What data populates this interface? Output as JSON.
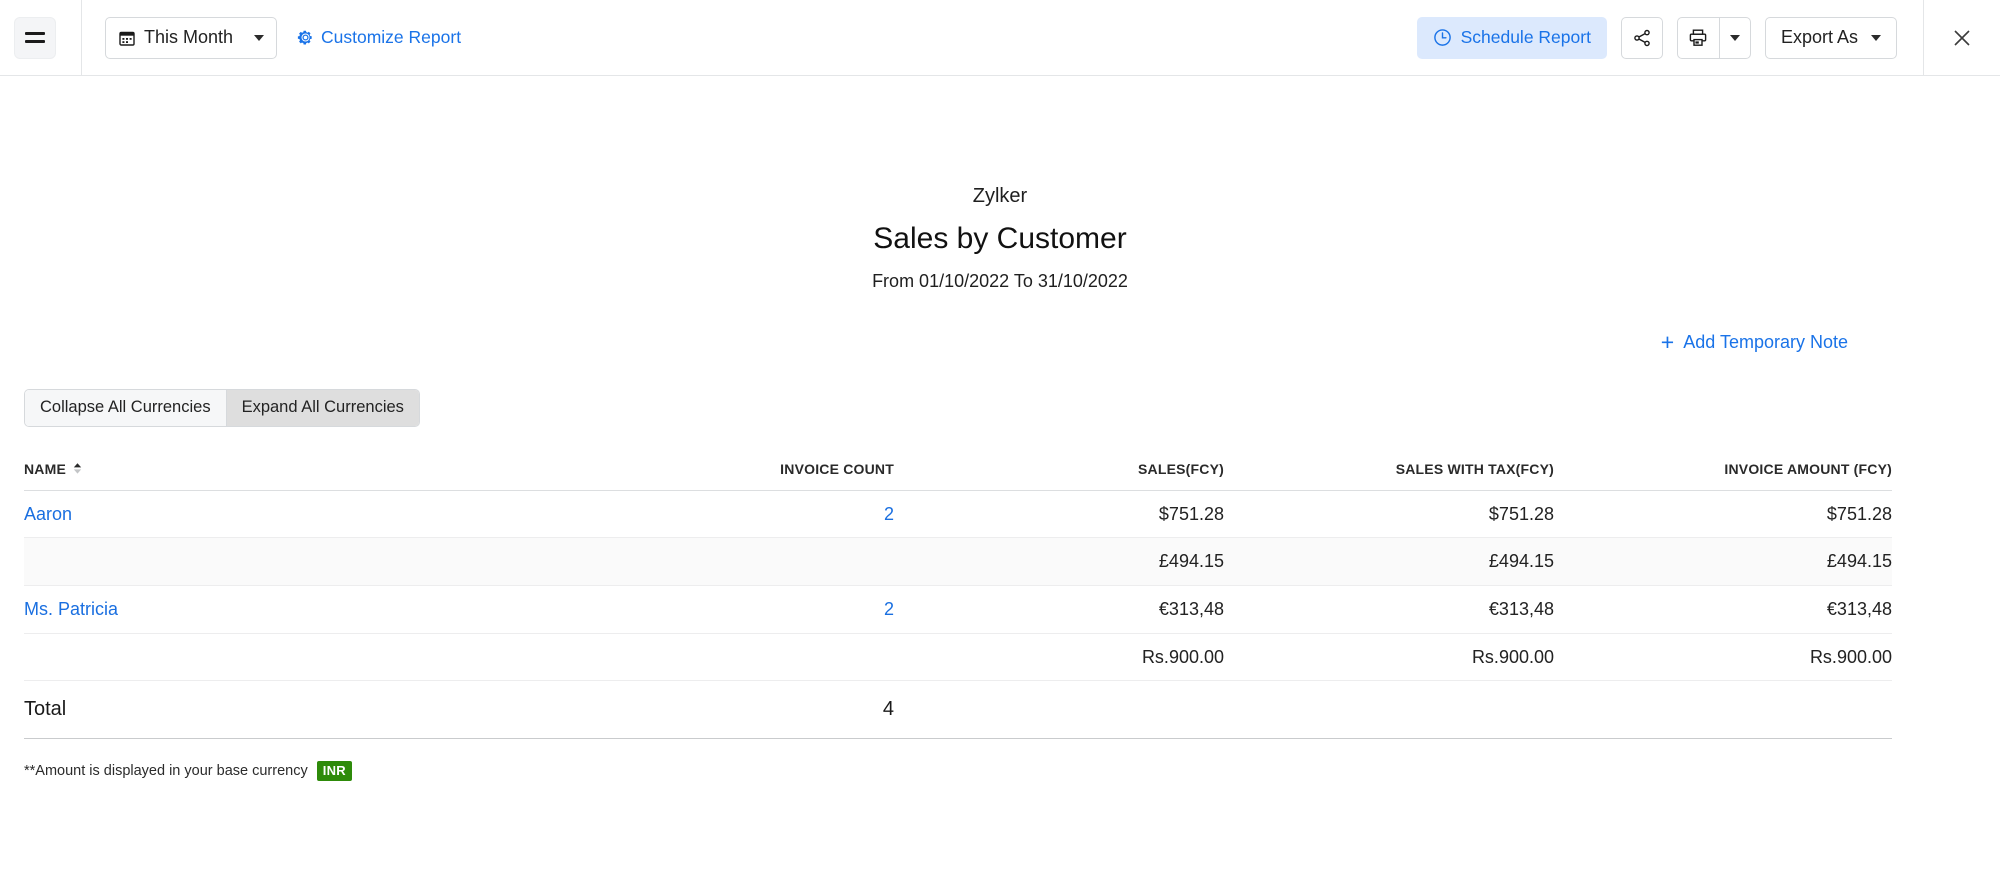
{
  "toolbar": {
    "menu_icon": "hamburger-icon",
    "date_filter": {
      "label": "This Month",
      "icon": "calendar-icon"
    },
    "customize": {
      "label": "Customize Report",
      "icon": "gear-icon"
    },
    "schedule": {
      "label": "Schedule Report",
      "icon": "clock-icon"
    },
    "share_icon": "share-icon",
    "print_icon": "printer-icon",
    "export": {
      "label": "Export As"
    },
    "close_icon": "close-icon",
    "accent_blue": "#1a73e8",
    "schedule_bg": "#dce9fd"
  },
  "report": {
    "organization": "Zylker",
    "title": "Sales by Customer",
    "date_range": "From 01/10/2022 To 31/10/2022",
    "add_note": {
      "label": "Add Temporary Note",
      "icon": "plus-icon"
    },
    "currency_toggle": {
      "collapse_label": "Collapse All Currencies",
      "expand_label": "Expand All Currencies",
      "active": "expand"
    },
    "footnote": {
      "text": "**Amount is displayed in your base currency",
      "badge": "INR",
      "badge_color": "#2e8b0a"
    }
  },
  "table": {
    "columns": [
      {
        "key": "name",
        "label": "NAME",
        "sorted": true,
        "sort_dir": "asc",
        "color": "#e8341b"
      },
      {
        "key": "count",
        "label": "INVOICE COUNT"
      },
      {
        "key": "sales",
        "label": "SALES(FCY)"
      },
      {
        "key": "tax",
        "label": "SALES WITH TAX(FCY)"
      },
      {
        "key": "amount",
        "label": "INVOICE AMOUNT (FCY)"
      }
    ],
    "rows": [
      {
        "name": "Aaron",
        "count": "2",
        "sales": "$751.28",
        "tax": "$751.28",
        "amount": "$751.28",
        "alt": false,
        "name_link": true,
        "count_link": true
      },
      {
        "name": "",
        "count": "",
        "sales": "£494.15",
        "tax": "£494.15",
        "amount": "£494.15",
        "alt": true,
        "name_link": false,
        "count_link": false
      },
      {
        "name": "Ms. Patricia",
        "count": "2",
        "sales": "€313,48",
        "tax": "€313,48",
        "amount": "€313,48",
        "alt": false,
        "name_link": true,
        "count_link": true
      },
      {
        "name": "",
        "count": "",
        "sales": "Rs.900.00",
        "tax": "Rs.900.00",
        "amount": "Rs.900.00",
        "alt": false,
        "name_link": false,
        "count_link": false
      }
    ],
    "total": {
      "label": "Total",
      "count": "4",
      "sales": "",
      "tax": "",
      "amount": ""
    }
  }
}
